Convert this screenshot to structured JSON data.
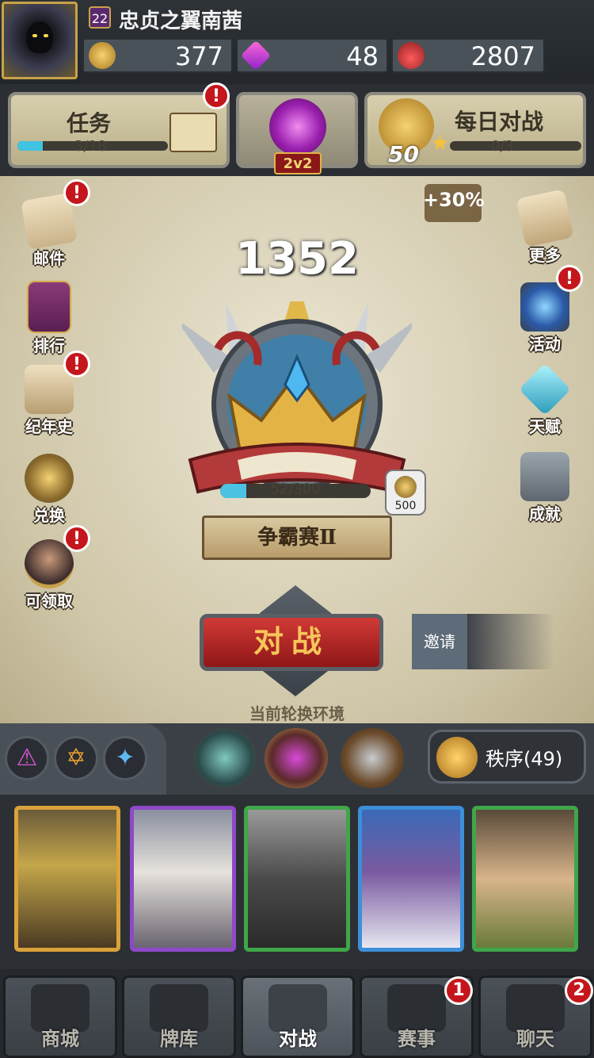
{
  "player": {
    "level": "22",
    "name": "忠贞之翼南茜"
  },
  "resources": {
    "gold": "377",
    "gems": "48",
    "potion": "2807"
  },
  "quests": {
    "label": "任务",
    "progress_text": "3/18",
    "progress": 0.1667,
    "alert": "!"
  },
  "mode": {
    "label": "2v2"
  },
  "daily": {
    "label": "每日对战",
    "coins": "50",
    "progress_text": "0/3",
    "bonus": "+30%"
  },
  "left_menu": [
    {
      "label": "邮件",
      "alert": "!"
    },
    {
      "label": "排行",
      "alert": ""
    },
    {
      "label": "纪年史",
      "alert": "!"
    },
    {
      "label": "兑换",
      "alert": ""
    },
    {
      "label": "可领取",
      "alert": "!"
    }
  ],
  "right_menu": [
    {
      "label": "更多",
      "alert": ""
    },
    {
      "label": "活动",
      "alert": "!"
    },
    {
      "label": "天赋",
      "alert": ""
    },
    {
      "label": "成就",
      "alert": ""
    }
  ],
  "rank": {
    "score": "1352",
    "name": "争霸赛Ⅱ",
    "progress_text": "52/300",
    "progress": 0.1733,
    "chest_value": "500"
  },
  "battle": {
    "label": "对战",
    "invite_label": "邀请"
  },
  "rotation": {
    "label": "当前轮换环境",
    "order_label": "秩序(49)"
  },
  "elements": [
    {
      "icon": "chaos-rune-icon",
      "glyph": "⚠",
      "color": "#d85ad8"
    },
    {
      "icon": "order-rune-icon",
      "glyph": "✡",
      "color": "#e8a030"
    },
    {
      "icon": "ice-rune-icon",
      "glyph": "✦",
      "color": "#60b8f0"
    }
  ],
  "cards": [
    {
      "frame": "#d9a23a",
      "art": "valkyrie"
    },
    {
      "frame": "#8e49c8",
      "art": "angel"
    },
    {
      "frame": "#3fa64a",
      "art": "warrior"
    },
    {
      "frame": "#3d8fd8",
      "art": "sage"
    },
    {
      "frame": "#3fa64a",
      "art": "child"
    }
  ],
  "nav": [
    {
      "label": "商城",
      "badge": "",
      "active": false
    },
    {
      "label": "牌库",
      "badge": "",
      "active": false
    },
    {
      "label": "对战",
      "badge": "",
      "active": true
    },
    {
      "label": "赛事",
      "badge": "1",
      "active": false
    },
    {
      "label": "聊天",
      "badge": "2",
      "active": false
    }
  ]
}
